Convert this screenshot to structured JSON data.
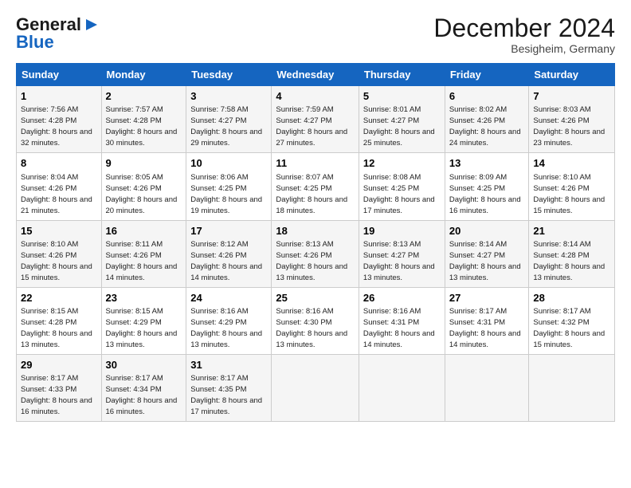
{
  "logo": {
    "line1": "General",
    "line2": "Blue"
  },
  "title": "December 2024",
  "subtitle": "Besigheim, Germany",
  "headers": [
    "Sunday",
    "Monday",
    "Tuesday",
    "Wednesday",
    "Thursday",
    "Friday",
    "Saturday"
  ],
  "weeks": [
    [
      {
        "day": "1",
        "sunrise": "7:56 AM",
        "sunset": "4:28 PM",
        "daylight": "8 hours and 32 minutes."
      },
      {
        "day": "2",
        "sunrise": "7:57 AM",
        "sunset": "4:28 PM",
        "daylight": "8 hours and 30 minutes."
      },
      {
        "day": "3",
        "sunrise": "7:58 AM",
        "sunset": "4:27 PM",
        "daylight": "8 hours and 29 minutes."
      },
      {
        "day": "4",
        "sunrise": "7:59 AM",
        "sunset": "4:27 PM",
        "daylight": "8 hours and 27 minutes."
      },
      {
        "day": "5",
        "sunrise": "8:01 AM",
        "sunset": "4:27 PM",
        "daylight": "8 hours and 25 minutes."
      },
      {
        "day": "6",
        "sunrise": "8:02 AM",
        "sunset": "4:26 PM",
        "daylight": "8 hours and 24 minutes."
      },
      {
        "day": "7",
        "sunrise": "8:03 AM",
        "sunset": "4:26 PM",
        "daylight": "8 hours and 23 minutes."
      }
    ],
    [
      {
        "day": "8",
        "sunrise": "8:04 AM",
        "sunset": "4:26 PM",
        "daylight": "8 hours and 21 minutes."
      },
      {
        "day": "9",
        "sunrise": "8:05 AM",
        "sunset": "4:26 PM",
        "daylight": "8 hours and 20 minutes."
      },
      {
        "day": "10",
        "sunrise": "8:06 AM",
        "sunset": "4:25 PM",
        "daylight": "8 hours and 19 minutes."
      },
      {
        "day": "11",
        "sunrise": "8:07 AM",
        "sunset": "4:25 PM",
        "daylight": "8 hours and 18 minutes."
      },
      {
        "day": "12",
        "sunrise": "8:08 AM",
        "sunset": "4:25 PM",
        "daylight": "8 hours and 17 minutes."
      },
      {
        "day": "13",
        "sunrise": "8:09 AM",
        "sunset": "4:25 PM",
        "daylight": "8 hours and 16 minutes."
      },
      {
        "day": "14",
        "sunrise": "8:10 AM",
        "sunset": "4:26 PM",
        "daylight": "8 hours and 15 minutes."
      }
    ],
    [
      {
        "day": "15",
        "sunrise": "8:10 AM",
        "sunset": "4:26 PM",
        "daylight": "8 hours and 15 minutes."
      },
      {
        "day": "16",
        "sunrise": "8:11 AM",
        "sunset": "4:26 PM",
        "daylight": "8 hours and 14 minutes."
      },
      {
        "day": "17",
        "sunrise": "8:12 AM",
        "sunset": "4:26 PM",
        "daylight": "8 hours and 14 minutes."
      },
      {
        "day": "18",
        "sunrise": "8:13 AM",
        "sunset": "4:26 PM",
        "daylight": "8 hours and 13 minutes."
      },
      {
        "day": "19",
        "sunrise": "8:13 AM",
        "sunset": "4:27 PM",
        "daylight": "8 hours and 13 minutes."
      },
      {
        "day": "20",
        "sunrise": "8:14 AM",
        "sunset": "4:27 PM",
        "daylight": "8 hours and 13 minutes."
      },
      {
        "day": "21",
        "sunrise": "8:14 AM",
        "sunset": "4:28 PM",
        "daylight": "8 hours and 13 minutes."
      }
    ],
    [
      {
        "day": "22",
        "sunrise": "8:15 AM",
        "sunset": "4:28 PM",
        "daylight": "8 hours and 13 minutes."
      },
      {
        "day": "23",
        "sunrise": "8:15 AM",
        "sunset": "4:29 PM",
        "daylight": "8 hours and 13 minutes."
      },
      {
        "day": "24",
        "sunrise": "8:16 AM",
        "sunset": "4:29 PM",
        "daylight": "8 hours and 13 minutes."
      },
      {
        "day": "25",
        "sunrise": "8:16 AM",
        "sunset": "4:30 PM",
        "daylight": "8 hours and 13 minutes."
      },
      {
        "day": "26",
        "sunrise": "8:16 AM",
        "sunset": "4:31 PM",
        "daylight": "8 hours and 14 minutes."
      },
      {
        "day": "27",
        "sunrise": "8:17 AM",
        "sunset": "4:31 PM",
        "daylight": "8 hours and 14 minutes."
      },
      {
        "day": "28",
        "sunrise": "8:17 AM",
        "sunset": "4:32 PM",
        "daylight": "8 hours and 15 minutes."
      }
    ],
    [
      {
        "day": "29",
        "sunrise": "8:17 AM",
        "sunset": "4:33 PM",
        "daylight": "8 hours and 16 minutes."
      },
      {
        "day": "30",
        "sunrise": "8:17 AM",
        "sunset": "4:34 PM",
        "daylight": "8 hours and 16 minutes."
      },
      {
        "day": "31",
        "sunrise": "8:17 AM",
        "sunset": "4:35 PM",
        "daylight": "8 hours and 17 minutes."
      },
      null,
      null,
      null,
      null
    ]
  ],
  "labels": {
    "sunrise": "Sunrise:",
    "sunset": "Sunset:",
    "daylight": "Daylight:"
  }
}
